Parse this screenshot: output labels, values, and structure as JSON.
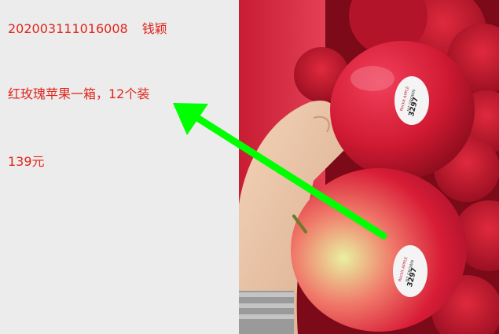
{
  "message": {
    "order_number": "202003111016008",
    "customer_name": "钱颖",
    "product_line": "红玫瑰苹果一箱，12个装",
    "price": "139元"
  },
  "photo": {
    "sticker_brand": "Rockit APPLE",
    "sticker_origin": "NZ GROWN",
    "sticker_code": "3297"
  },
  "arrow": {
    "color": "#00ff00"
  }
}
